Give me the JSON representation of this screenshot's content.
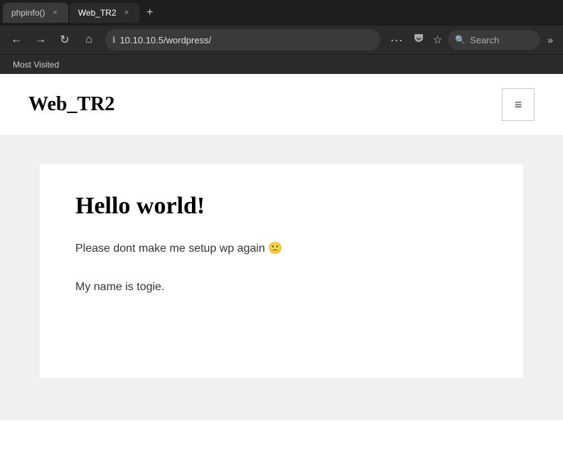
{
  "browser": {
    "tabs": [
      {
        "id": "tab-phpinfo",
        "label": "phpinfo()",
        "active": false,
        "close": "×"
      },
      {
        "id": "tab-web-tr2",
        "label": "Web_TR2",
        "active": true,
        "close": "×"
      }
    ],
    "new_tab_label": "+",
    "nav": {
      "back_title": "Back",
      "forward_title": "Forward",
      "reload_title": "Reload",
      "home_title": "Home"
    },
    "address": {
      "lock": "ℹ",
      "url": "10.10.10.5/wordpress/"
    },
    "dots": "···",
    "pocket_label": "🏷",
    "star_label": "☆",
    "search": {
      "icon": "🔍",
      "placeholder": "Search"
    },
    "more": "»",
    "bookmarks": [
      {
        "label": "Most Visited"
      }
    ]
  },
  "page": {
    "site_title": "Web_TR2",
    "hamburger_icon": "≡",
    "post": {
      "title": "Hello world!",
      "body": "Please dont make me setup wp again 🙁",
      "secondary": "My name is togie."
    }
  }
}
